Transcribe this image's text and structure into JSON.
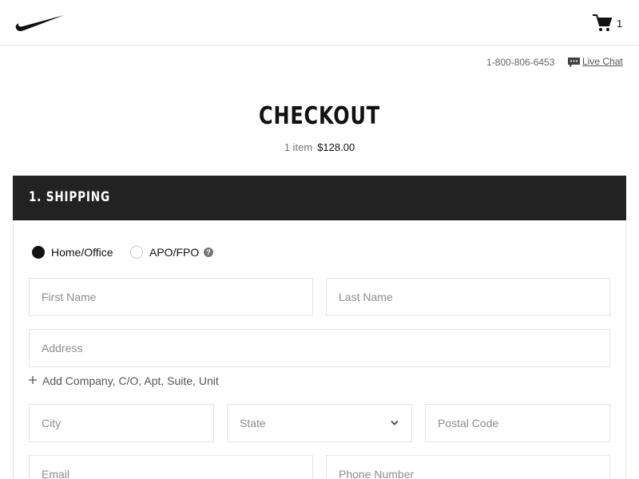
{
  "header": {
    "logo_icon": "nike-swoosh-icon",
    "cart_icon": "cart-icon",
    "cart_count": "1"
  },
  "utility": {
    "phone": "1-800-806-6453",
    "chat_icon": "chat-bubble-icon",
    "live_chat": "Live Chat"
  },
  "checkout": {
    "title": "CHECKOUT",
    "item_count": "1 item",
    "total": "$128.00"
  },
  "shipping": {
    "section_title": "1. SHIPPING",
    "address_types": [
      {
        "label": "Home/Office",
        "selected": true
      },
      {
        "label": "APO/FPO",
        "selected": false
      }
    ],
    "help_icon": "question-icon",
    "fields": {
      "first_name": "First Name",
      "last_name": "Last Name",
      "address": "Address",
      "add_company": "Add Company, C/O, Apt, Suite, Unit",
      "city": "City",
      "state": "State",
      "postal_code": "Postal Code",
      "email": "Email",
      "phone": "Phone Number"
    }
  },
  "colors": {
    "section_bar": "#222222",
    "border": "#e5e5e5",
    "placeholder": "#8d8d8d"
  }
}
